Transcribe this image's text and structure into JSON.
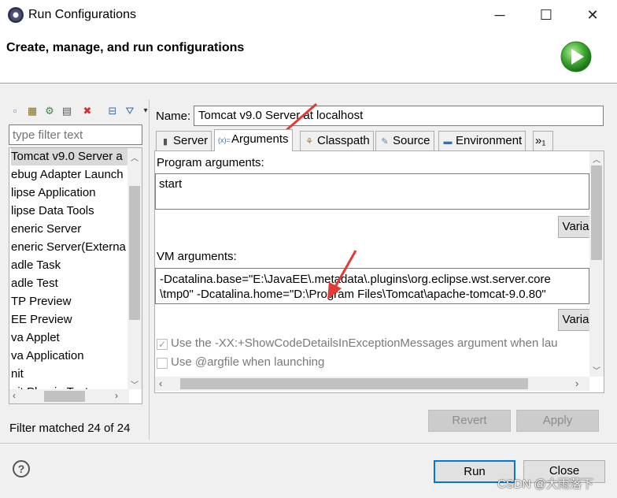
{
  "window": {
    "title": "Run Configurations",
    "minimize": "─",
    "maximize": "☐",
    "close": "✕"
  },
  "banner": {
    "title": "Create, manage, and run configurations"
  },
  "left": {
    "toolbar_icons": [
      "new-config-icon",
      "new-prototype-icon",
      "export-icon",
      "duplicate-icon",
      "delete-icon",
      "collapse-all-icon",
      "filter-icon",
      "view-menu-icon"
    ],
    "filter_placeholder": "type filter text",
    "items": [
      "Tomcat v9.0 Server a",
      "ebug Adapter Launch",
      "lipse Application",
      "lipse Data Tools",
      "eneric Server",
      "eneric Server(Externa",
      "adle Task",
      "adle Test",
      "TP Preview",
      "EE Preview",
      "va Applet",
      "va Application",
      "nit",
      "nit Plug-in Test"
    ],
    "filter_status": "Filter matched 24 of 24"
  },
  "config": {
    "name_label": "Name:",
    "name_value": "Tomcat v9.0 Server at localhost",
    "tabs": [
      "Server",
      "Arguments",
      "Classpath",
      "Source",
      "Environment",
      "»₁"
    ],
    "program_args_label": "Program arguments:",
    "program_args_value": "start",
    "variables_label": "Varia",
    "vm_args_label": "VM arguments:",
    "vm_args_line1": "-Dcatalina.base=\"E:\\JavaEE\\.metadata\\.plugins\\org.eclipse.wst.server.core",
    "vm_args_line2": "\\tmp0\" -Dcatalina.home=\"D:\\Program Files\\Tomcat\\apache-tomcat-9.0.80\"",
    "vm_variables_label": "Varia",
    "showcode_label": "Use the -XX:+ShowCodeDetailsInExceptionMessages argument when lau",
    "showcode_checked": true,
    "argfile_label": "Use @argfile when launching",
    "argfile_checked": false
  },
  "buttons": {
    "revert": "Revert",
    "apply": "Apply",
    "run": "Run",
    "close": "Close"
  },
  "watermark": "CSDN @大雨落下",
  "colors": {
    "accent_blue": "#0078d7",
    "arrow_red": "#e53935",
    "run_green": "#3aa52f"
  }
}
